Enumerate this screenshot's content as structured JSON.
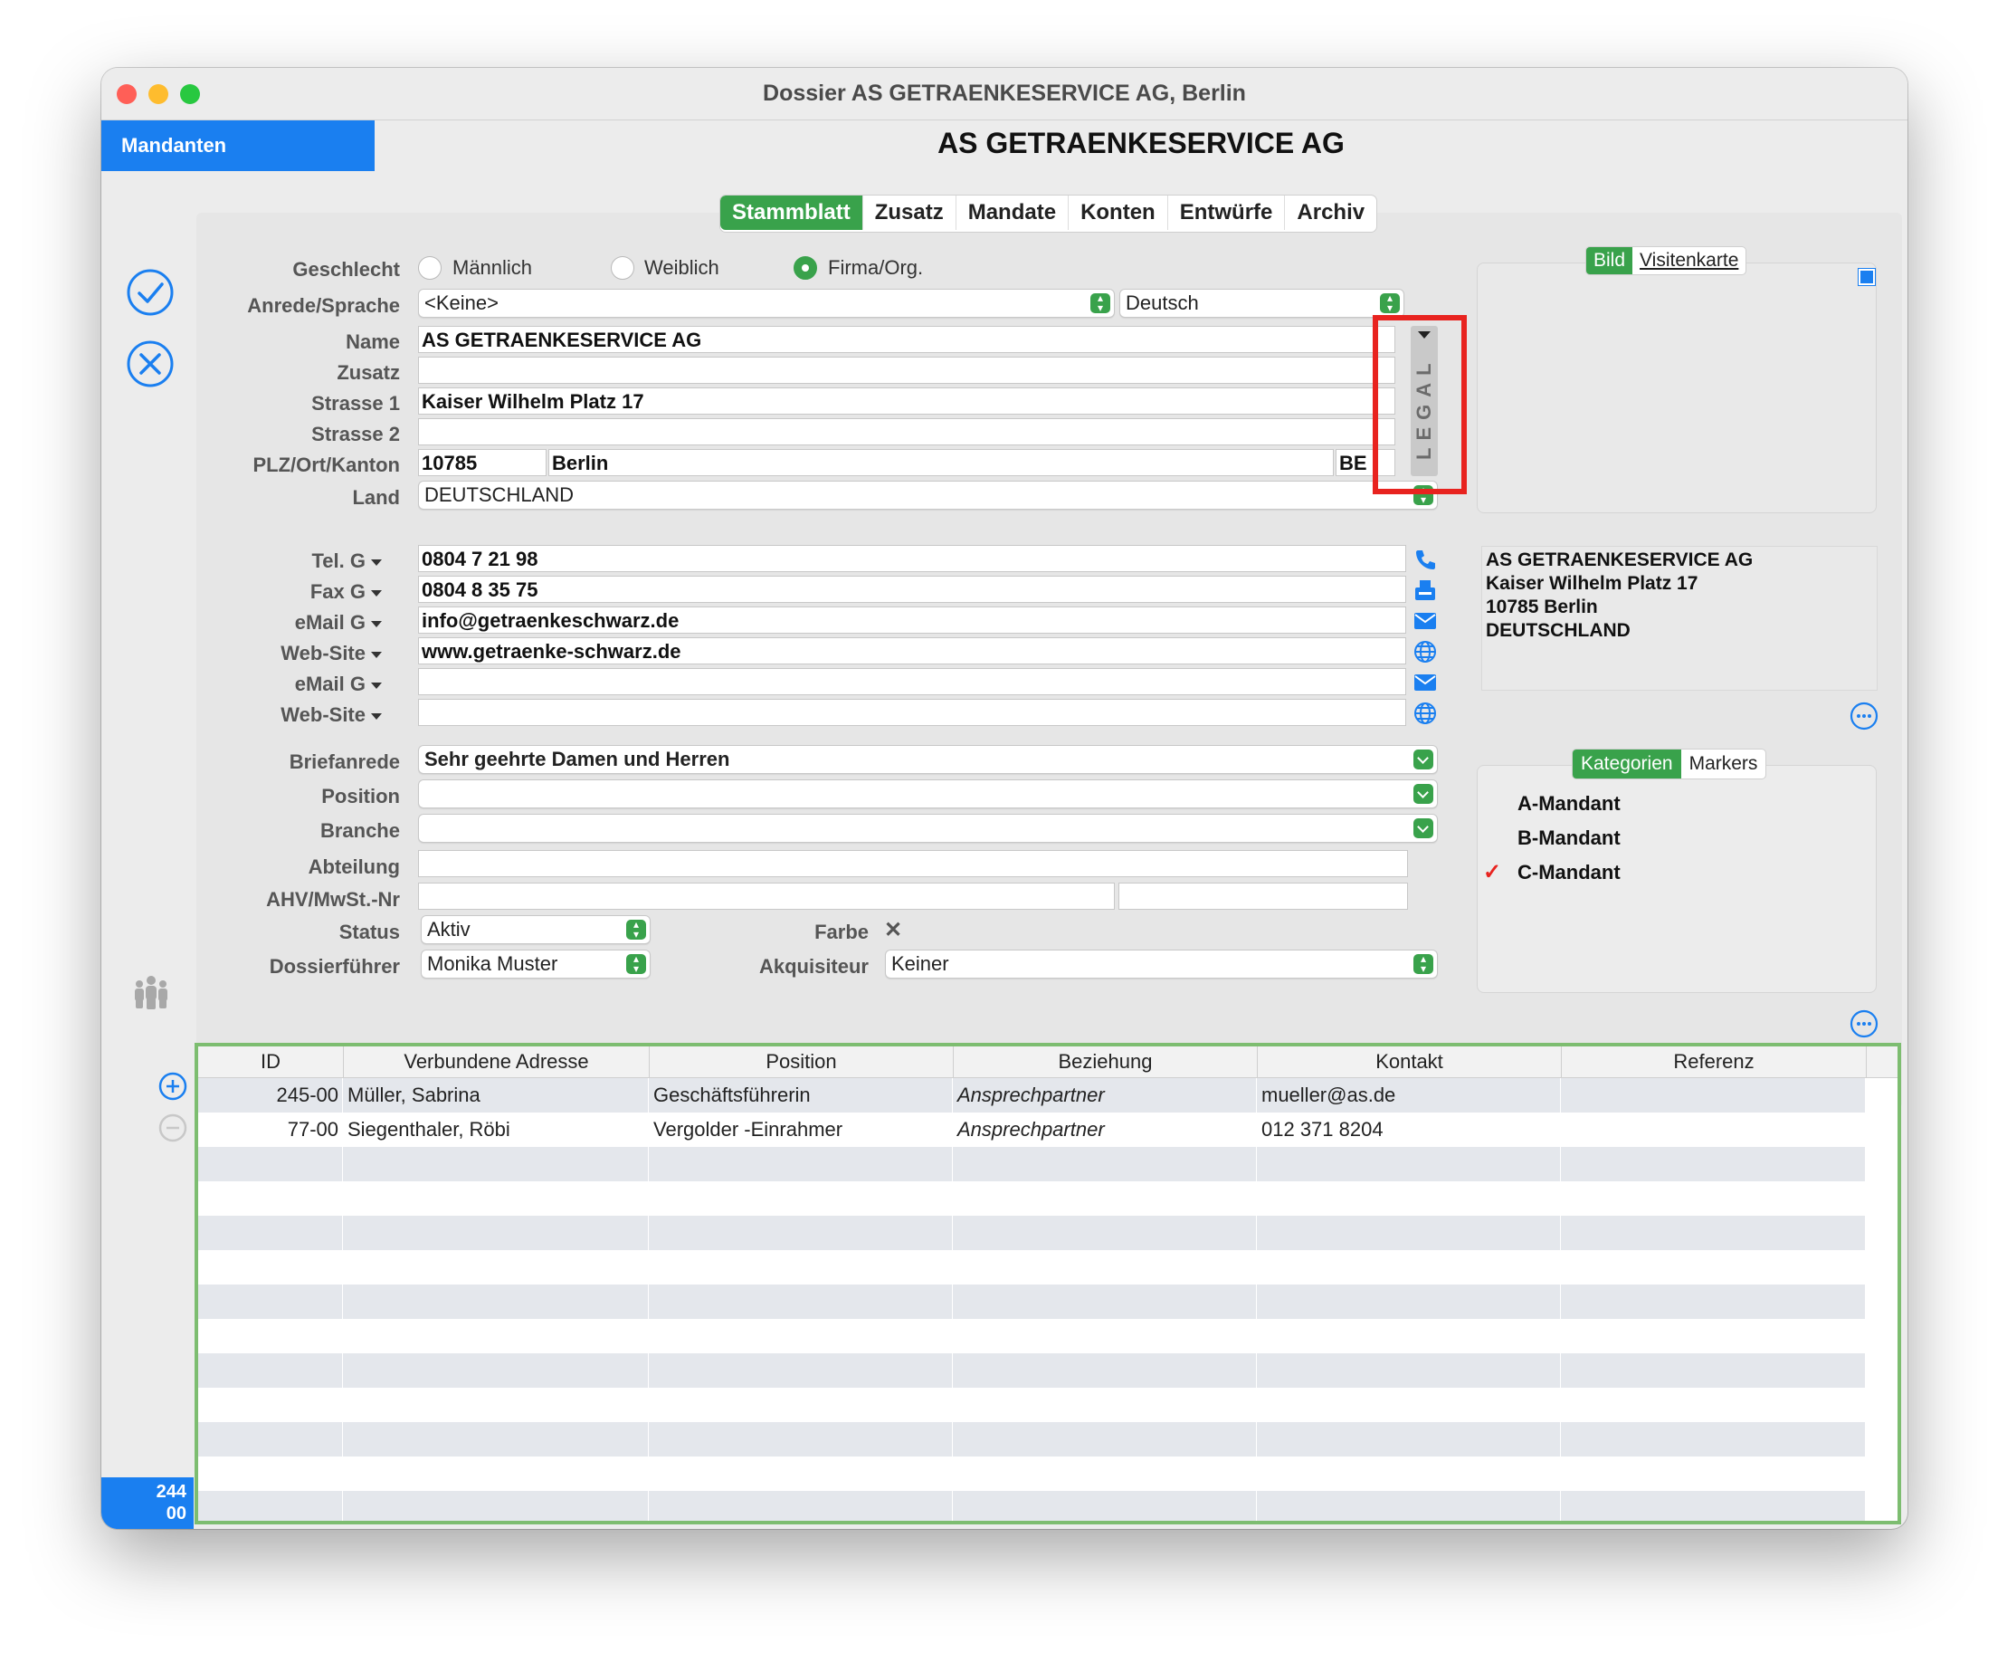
{
  "window": {
    "title": "Dossier AS GETRAENKESERVICE AG, Berlin"
  },
  "sidebar": {
    "header": "Mandanten",
    "counter_line1": "244",
    "counter_line2": "00"
  },
  "main": {
    "title": "AS GETRAENKESERVICE AG"
  },
  "tabs": [
    "Stammblatt",
    "Zusatz",
    "Mandate",
    "Konten",
    "Entwürfe",
    "Archiv"
  ],
  "form": {
    "geschlecht_label": "Geschlecht",
    "gender_options": [
      "Männlich",
      "Weiblich",
      "Firma/Org."
    ],
    "anrede_label": "Anrede/Sprache",
    "anrede_value": "<Keine>",
    "sprache_value": "Deutsch",
    "name_label": "Name",
    "name_value": "AS GETRAENKESERVICE AG",
    "zusatz_label": "Zusatz",
    "zusatz_value": "",
    "strasse1_label": "Strasse 1",
    "strasse1_value": "Kaiser Wilhelm Platz 17",
    "strasse2_label": "Strasse 2",
    "strasse2_value": "",
    "plz_label": "PLZ/Ort/Kanton",
    "plz_value": "10785",
    "ort_value": "Berlin",
    "kanton_value": "BE",
    "land_label": "Land",
    "land_value": "DEUTSCHLAND",
    "legal_text": "LEGAL",
    "contacts": [
      {
        "label": "Tel. G",
        "value": "0804 7 21 98",
        "icon": "phone-icon"
      },
      {
        "label": "Fax G",
        "value": "0804 8 35 75",
        "icon": "fax-icon"
      },
      {
        "label": "eMail G",
        "value": "info@getraenkeschwarz.de",
        "icon": "mail-icon"
      },
      {
        "label": "Web-Site",
        "value": "www.getraenke-schwarz.de",
        "icon": "globe-icon"
      },
      {
        "label": "eMail G",
        "value": "",
        "icon": "mail-icon"
      },
      {
        "label": "Web-Site",
        "value": "",
        "icon": "globe-icon"
      }
    ],
    "briefanrede_label": "Briefanrede",
    "briefanrede_value": "Sehr geehrte Damen und Herren",
    "position_label": "Position",
    "branche_label": "Branche",
    "abteilung_label": "Abteilung",
    "ahv_label": "AHV/MwSt.-Nr",
    "status_label": "Status",
    "status_value": "Aktiv",
    "farbe_label": "Farbe",
    "farbe_value": "✕",
    "dossierfuehrer_label": "Dossierführer",
    "dossierfuehrer_value": "Monika Muster",
    "akquisiteur_label": "Akquisiteur",
    "akquisiteur_value": "Keiner"
  },
  "right": {
    "image_tabs": [
      "Bild",
      "Visitenkarte"
    ],
    "address_lines": [
      "AS GETRAENKESERVICE AG",
      "Kaiser Wilhelm Platz 17",
      "10785 Berlin",
      "DEUTSCHLAND"
    ],
    "cat_tabs": [
      "Kategorien",
      "Markers"
    ],
    "categories": [
      {
        "name": "A-Mandant",
        "checked": false
      },
      {
        "name": "B-Mandant",
        "checked": false
      },
      {
        "name": "C-Mandant",
        "checked": true
      }
    ],
    "check_glyph": "✓"
  },
  "table": {
    "headers": [
      "ID",
      "Verbundene Adresse",
      "Position",
      "Beziehung",
      "Kontakt",
      "Referenz"
    ],
    "rows": [
      [
        "245-00",
        "Müller, Sabrina",
        "Geschäftsführerin",
        "Ansprechpartner",
        "mueller@as.de",
        ""
      ],
      [
        "77-00",
        "Siegenthaler, Röbi",
        "Vergolder -Einrahmer",
        "Ansprechpartner",
        "012 371 8204",
        ""
      ]
    ]
  },
  "colors": {
    "accent_green": "#39a24b",
    "sidebar_blue": "#1a7ff0",
    "highlight_red": "#e8231f",
    "table_border": "#7dbd70"
  }
}
